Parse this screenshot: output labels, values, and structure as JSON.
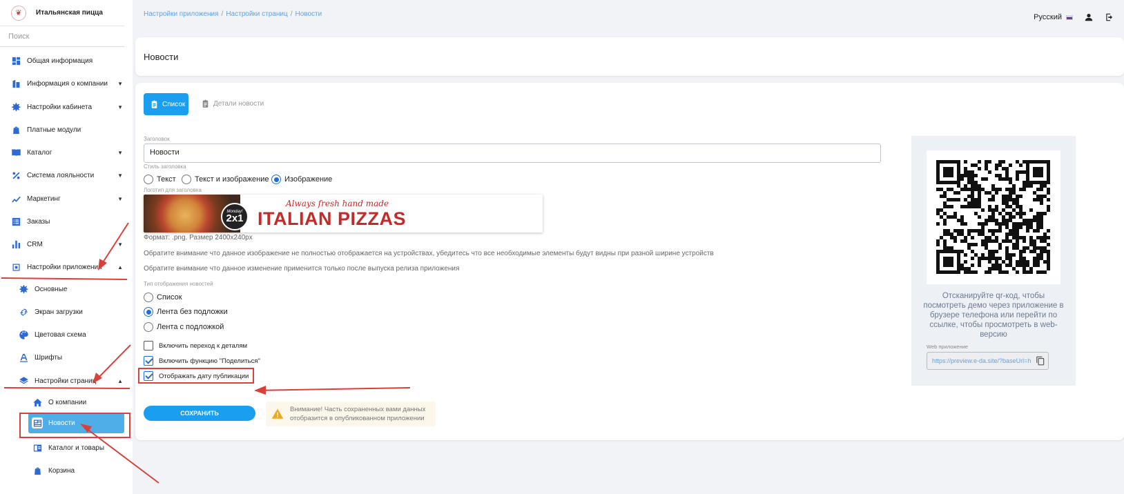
{
  "brand": {
    "name": "Итальянская пицца",
    "logo_glyph": "❦"
  },
  "sidebar": {
    "search_placeholder": "Поиск",
    "items": [
      {
        "label": "Общая информация",
        "icon": "dashboard-icon"
      },
      {
        "label": "Информация о компании",
        "icon": "building-icon",
        "caret": "▼"
      },
      {
        "label": "Настройки кабинета",
        "icon": "gears-icon",
        "caret": "▼"
      },
      {
        "label": "Платные модули",
        "icon": "bag-icon"
      },
      {
        "label": "Каталог",
        "icon": "book-icon",
        "caret": "▼"
      },
      {
        "label": "Система лояльности",
        "icon": "percent-icon",
        "caret": "▼"
      },
      {
        "label": "Маркетинг",
        "icon": "chart-line-icon",
        "caret": "▼"
      },
      {
        "label": "Заказы",
        "icon": "list-icon"
      },
      {
        "label": "CRM",
        "icon": "bar-chart-icon",
        "caret": "▼"
      },
      {
        "label": "Настройки приложения",
        "icon": "app-settings-icon",
        "caret": "▲"
      },
      {
        "label": "Основные",
        "icon": "gear-icon"
      },
      {
        "label": "Экран загрузки",
        "icon": "refresh-icon"
      },
      {
        "label": "Цветовая схема",
        "icon": "palette-icon"
      },
      {
        "label": "Шрифты",
        "icon": "font-icon"
      },
      {
        "label": "Настройки страниц",
        "icon": "layers-icon",
        "caret": "▲"
      },
      {
        "label": "О компании",
        "icon": "home-icon"
      },
      {
        "label": "Новости",
        "icon": "news-icon"
      },
      {
        "label": "Каталог и товары",
        "icon": "catalog-icon"
      },
      {
        "label": "Корзина",
        "icon": "bag-icon"
      }
    ]
  },
  "breadcrumb": [
    "Настройки приложения",
    "Настройки страниц",
    "Новости"
  ],
  "breadcrumb_sep": "/",
  "language": "Русский",
  "page_title": "Новости",
  "tabs": {
    "list": "Список",
    "details": "Детали новости"
  },
  "form": {
    "title_label": "Заголовок",
    "title_value": "Новости",
    "title_style_label": "Стиль заголовка",
    "title_style_options": [
      "Текст",
      "Текст и изображение",
      "Изображение"
    ],
    "title_style_selected": "Изображение",
    "logo_label": "Логотип для заголовка",
    "banner": {
      "tagline": "Always fresh hand made",
      "badge_top": "Monday!",
      "badge_main": "2x1",
      "headline": "ITALIAN PIZZAS"
    },
    "format_note": "Формат: .png. Размер 2400x240px",
    "note_1": "Обратите внимание что данное изображение не полностью отображается на устройствах, убедитесь что все необходимые элементы будут видны при разной ширине устройств",
    "note_2": "Обратите внимание что данное изменение применится только после выпуска релиза приложения",
    "display_type_label": "Тип отображения новостей",
    "display_type_options": [
      "Список",
      "Лента без подложки",
      "Лента с подложкой"
    ],
    "display_type_selected": "Лента без подложки",
    "checkboxes": [
      {
        "label": "Включить переход к деталям",
        "checked": false
      },
      {
        "label": "Включить функцию \"Поделиться\"",
        "checked": true
      },
      {
        "label": "Отображать дату публикации",
        "checked": true
      }
    ],
    "save_label": "СОХРАНИТЬ",
    "warning": "Внимание! Часть сохраненных вами данных отобразится в опубликованном приложении"
  },
  "qr": {
    "text": "Отсканируйте qr-код, чтобы посмотреть демо через приложение в брузере телефона или перейти по ссылке, чтобы просмотреть в web-версию",
    "web_label": "Web приложение",
    "web_url": "https://preview.e-da.site/?baseUrl=h"
  },
  "colors": {
    "accent": "#1a9ff0",
    "active_item": "#4faee8",
    "annotation": "#d9403a",
    "brand_red": "#c42a2a"
  }
}
